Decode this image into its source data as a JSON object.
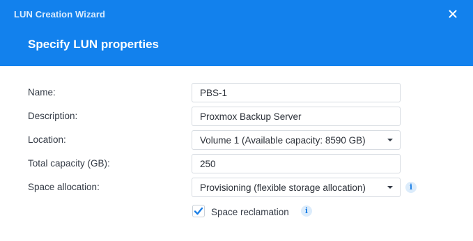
{
  "dialog": {
    "window_title": "LUN Creation Wizard",
    "step_title": "Specify LUN properties",
    "close_icon": "close-icon"
  },
  "form": {
    "name": {
      "label": "Name:",
      "value": "PBS-1"
    },
    "description": {
      "label": "Description:",
      "value": "Proxmox Backup Server"
    },
    "location": {
      "label": "Location:",
      "value": "Volume 1 (Available capacity: 8590 GB)"
    },
    "capacity": {
      "label": "Total capacity (GB):",
      "value": "250"
    },
    "allocation": {
      "label": "Space allocation:",
      "value": "Provisioning (flexible storage allocation)",
      "info_icon": "i"
    },
    "reclamation": {
      "label": "Space reclamation",
      "checked": true,
      "info_icon": "i"
    }
  },
  "colors": {
    "header": "#1281ed",
    "accent": "#1a7ee6"
  }
}
